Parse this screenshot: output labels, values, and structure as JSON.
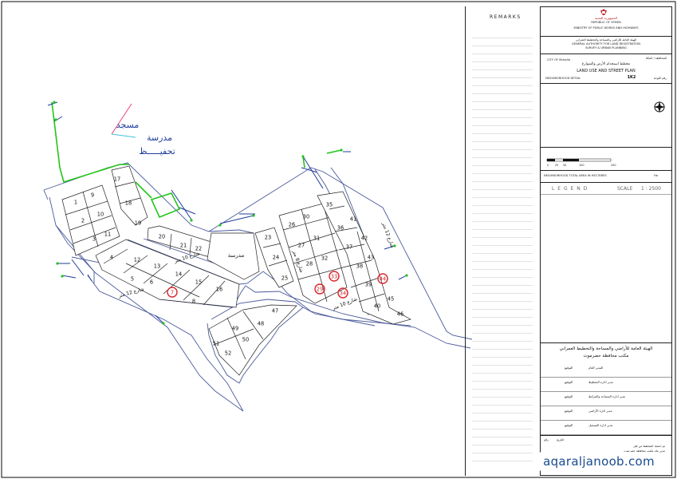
{
  "map": {
    "lots": [
      {
        "n": "9"
      },
      {
        "n": "1"
      },
      {
        "n": "10"
      },
      {
        "n": "2"
      },
      {
        "n": "11"
      },
      {
        "n": "3"
      },
      {
        "n": "4"
      },
      {
        "n": "17"
      },
      {
        "n": "18"
      },
      {
        "n": "19"
      },
      {
        "n": "20"
      },
      {
        "n": "21"
      },
      {
        "n": "22"
      },
      {
        "n": "12"
      },
      {
        "n": "5"
      },
      {
        "n": "13"
      },
      {
        "n": "6"
      },
      {
        "n": "14"
      },
      {
        "n": "7",
        "highlight": true
      },
      {
        "n": "15"
      },
      {
        "n": "8"
      },
      {
        "n": "16"
      },
      {
        "n": "23"
      },
      {
        "n": "24"
      },
      {
        "n": "25"
      },
      {
        "n": "26"
      },
      {
        "n": "27"
      },
      {
        "n": "28"
      },
      {
        "n": "30"
      },
      {
        "n": "31"
      },
      {
        "n": "32"
      },
      {
        "n": "33",
        "highlight": true
      },
      {
        "n": "29",
        "highlight": true
      },
      {
        "n": "34",
        "highlight": true
      },
      {
        "n": "35"
      },
      {
        "n": "41"
      },
      {
        "n": "36"
      },
      {
        "n": "42"
      },
      {
        "n": "37"
      },
      {
        "n": "43"
      },
      {
        "n": "38"
      },
      {
        "n": "44",
        "highlight": true
      },
      {
        "n": "39"
      },
      {
        "n": "40"
      },
      {
        "n": "45"
      },
      {
        "n": "46"
      },
      {
        "n": "47"
      },
      {
        "n": "48"
      },
      {
        "n": "49"
      },
      {
        "n": "50"
      },
      {
        "n": "51"
      },
      {
        "n": "52"
      }
    ],
    "school_label": "مدرسة",
    "mosque_label": "مسجد",
    "tahfeez_label_1": "مدرسة",
    "tahfeez_label_2": "تحفيـــــظ",
    "street_10_a": "شارع 10 متر",
    "street_10_b": "شارع 10 متر",
    "street_12": "شارع 12 متر",
    "street_12_b": "شارع 12 متر",
    "street_8": "شارع 8 متر",
    "highlight_color": "#d9262b",
    "green_color": "#22c51a",
    "blue_color": "#1f3d9a"
  },
  "remarks": {
    "title": "REMARKS"
  },
  "title_block": {
    "country_ar": "الجمهورية اليمنية",
    "country_en": "REPUBLIC OF YEMEN",
    "ministry": "MINISTRY OF PUBLIC WORKS AND HIGHWAYS",
    "authority_ar": "الهيئة العامة للأراضي والمساحة والتخطيط العمراني",
    "authority_en_1": "GENERAL AUTHORITY FOR LAND REGISTRATION",
    "authority_en_2": "SURVEY & URBAN PLANNING",
    "city_label": "CITY OF Mukalla",
    "city_ar": "المحافظة / المكلا",
    "plan_ar": "مخطط استخدام الأرض والشوارع",
    "plan_en": "LAND USE AND STREET PLAN",
    "neighborhood_label": "NEIGHBORHOOD DETAIL",
    "sheet_code": "1K2",
    "sheet_ar": "رقم اللوحة",
    "area_label": "NEIGHBORHOOD TOTAL AREA IN HECTARES",
    "area_unit": "Ha",
    "legend": "L E G E N D",
    "scale_label": "SCALE",
    "scale_value": "1 : 2500",
    "scale_ticks": [
      "0",
      "25",
      "50",
      "100",
      "200"
    ],
    "office_ar_1": "الهيئة العامة للأراضي والمساحة والتخطيط العمراني",
    "office_ar_2": "مكتب محافظة حضرموت",
    "sign_rows": [
      {
        "ar": "المدير العام"
      },
      {
        "ar": "مدير ادارة التخطيط"
      },
      {
        "ar": "مدير ادارة المساحة والخرائط"
      },
      {
        "ar": "مدير ادارة الأراضي"
      },
      {
        "ar": "مدير ادارة التسجيل"
      }
    ],
    "sign_label": "التوقيع",
    "date_label": "التاريخ",
    "no_label": "رقم",
    "footer_ar_1": "تم اعتماد المخطط من قبل",
    "footer_ar_2": "مدير عام مكتب محافظة حضرموت"
  },
  "watermark": "aqaraljanoob.com"
}
